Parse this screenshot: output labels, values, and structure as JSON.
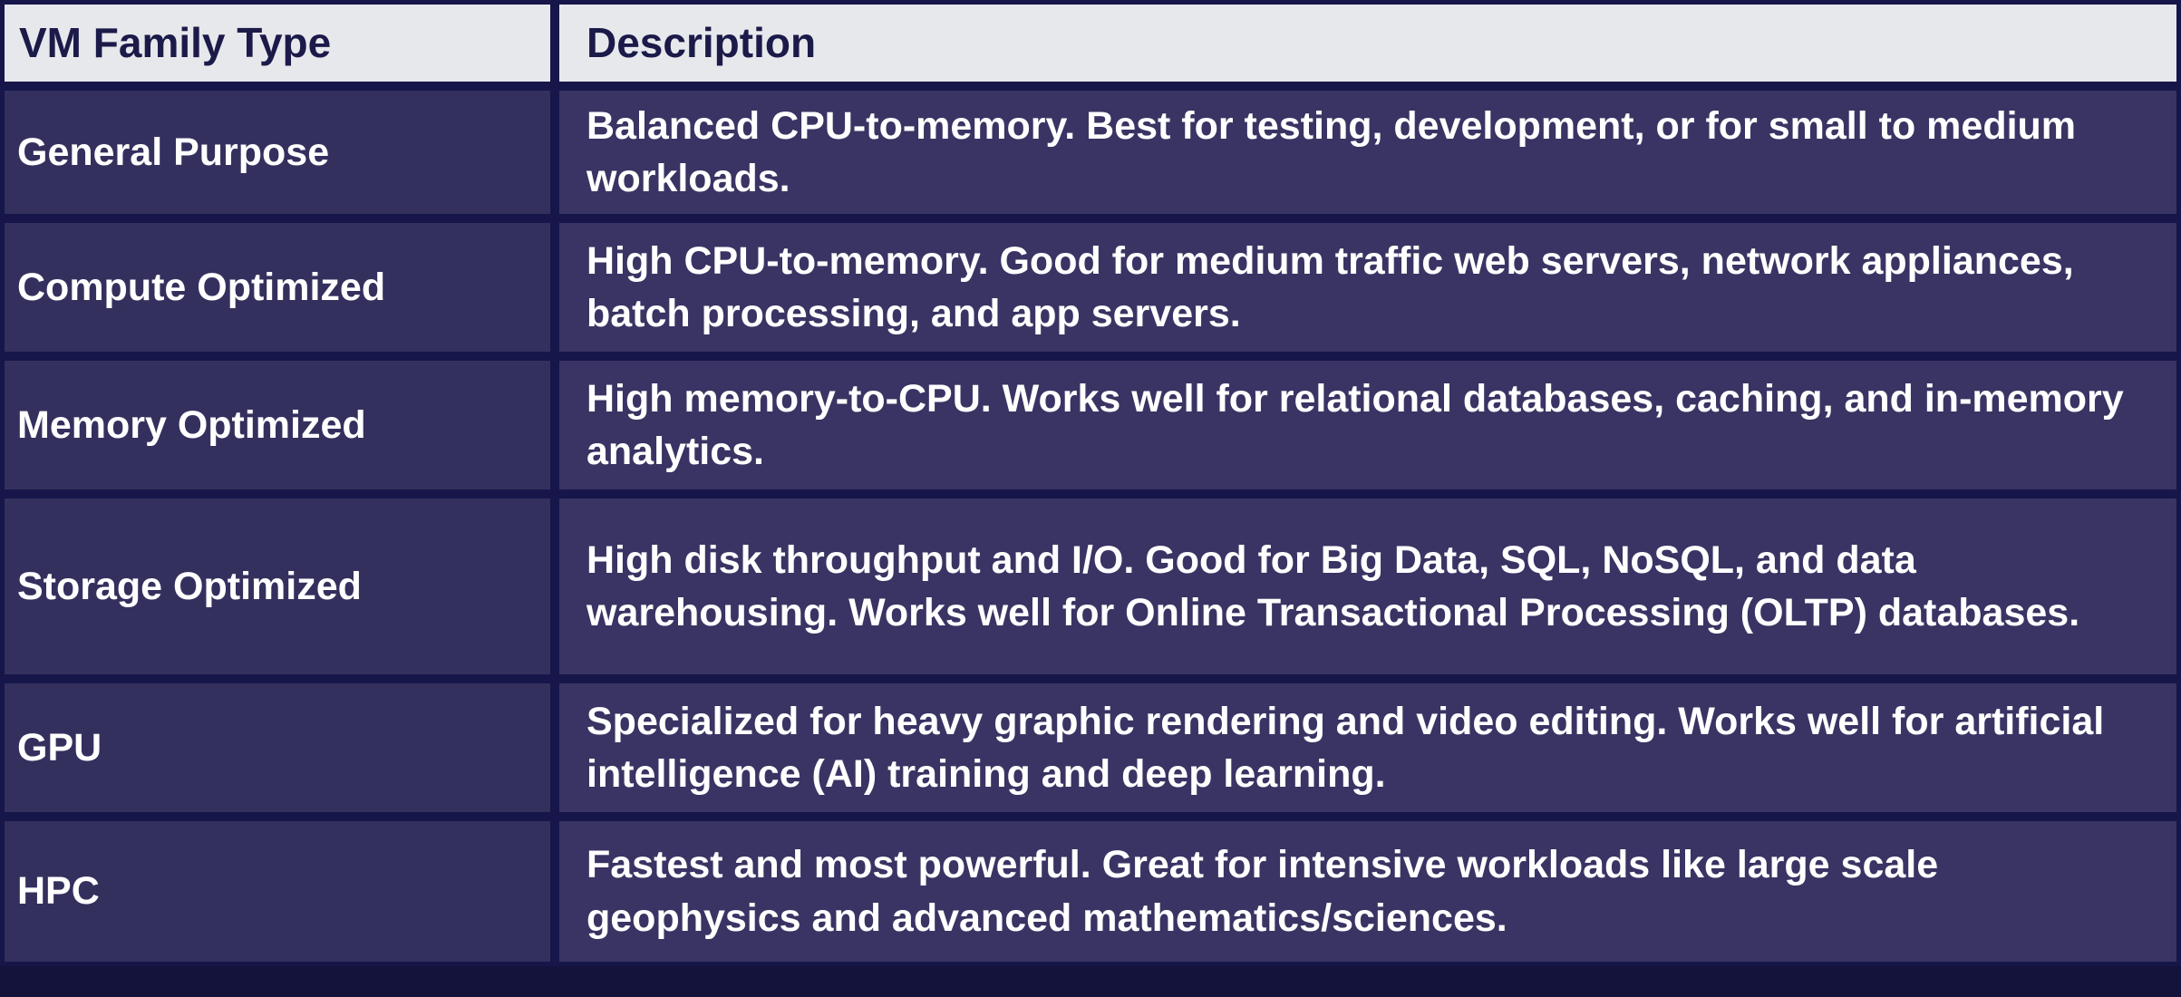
{
  "table": {
    "headers": {
      "type": "VM Family Type",
      "description": "Description"
    },
    "rows": [
      {
        "type": "General Purpose",
        "description": "Balanced CPU-to-memory. Best for testing, development, or for small to medium workloads."
      },
      {
        "type": "Compute Optimized",
        "description": "High CPU-to-memory. Good for medium traffic web servers, network appliances, batch processing, and app servers."
      },
      {
        "type": "Memory Optimized",
        "description": "High memory-to-CPU. Works well for relational databases, caching, and in-memory analytics."
      },
      {
        "type": "Storage Optimized",
        "description": "High disk throughput and I/O. Good for Big Data, SQL, NoSQL, and data warehousing. Works well for Online Transactional Processing (OLTP) databases."
      },
      {
        "type": "GPU",
        "description": "Specialized for heavy graphic rendering and video editing. Works well for artificial intelligence (AI) training and deep learning."
      },
      {
        "type": "HPC",
        "description": "Fastest and most powerful. Great for intensive workloads like large scale geophysics and advanced mathematics/sciences."
      }
    ]
  },
  "colors": {
    "background": "#13133c",
    "header_bg": "#e7e8ec",
    "header_text": "#1b1a49",
    "cell_bg": "#393463",
    "cell_text": "#ffffff"
  }
}
